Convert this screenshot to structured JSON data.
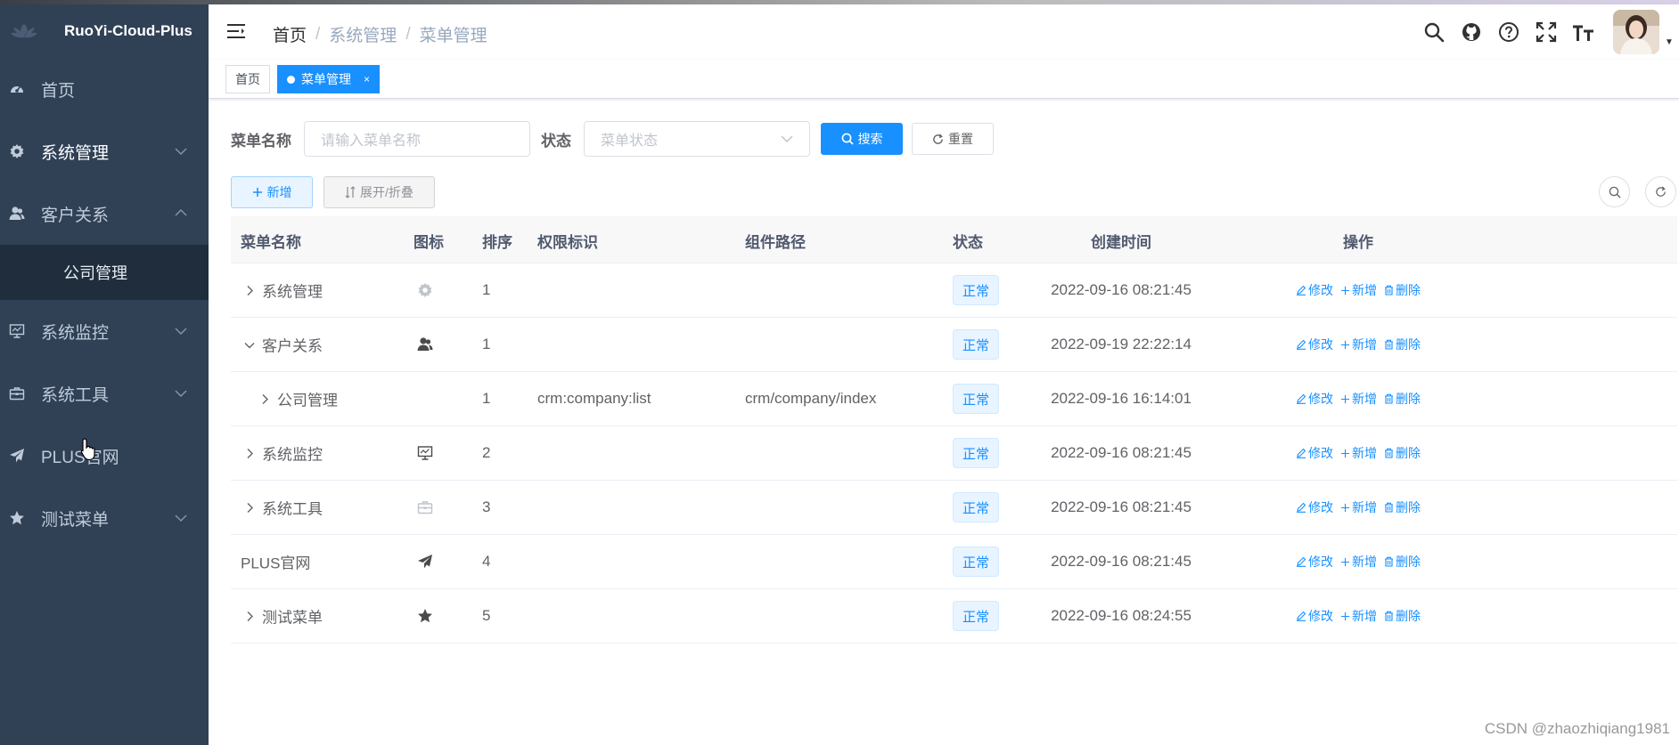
{
  "app": {
    "title": "RuoYi-Cloud-Plus"
  },
  "sidebar": {
    "items": [
      {
        "label": "首页",
        "icon": "dashboard-icon",
        "has_arrow": false
      },
      {
        "label": "系统管理",
        "icon": "gear-icon",
        "has_arrow": true,
        "expanded": false
      },
      {
        "label": "客户关系",
        "icon": "peoples-icon",
        "has_arrow": true,
        "expanded": true
      },
      {
        "label": "系统监控",
        "icon": "monitor-icon",
        "has_arrow": true,
        "expanded": false
      },
      {
        "label": "系统工具",
        "icon": "toolbox-icon",
        "has_arrow": true,
        "expanded": false
      },
      {
        "label": "PLUS官网",
        "icon": "paper-plane-icon",
        "has_arrow": false
      },
      {
        "label": "测试菜单",
        "icon": "star-icon",
        "has_arrow": true,
        "expanded": false
      }
    ],
    "submenu": [
      {
        "label": "公司管理"
      }
    ]
  },
  "header": {
    "breadcrumb": [
      "首页",
      "系统管理",
      "菜单管理"
    ],
    "icons": [
      "search-icon",
      "github-icon",
      "question-icon",
      "fullscreen-icon",
      "font-size-icon"
    ]
  },
  "tags": [
    {
      "label": "首页",
      "active": false
    },
    {
      "label": "菜单管理",
      "active": true,
      "close": "×"
    }
  ],
  "search": {
    "name_label": "菜单名称",
    "name_placeholder": "请输入菜单名称",
    "status_label": "状态",
    "status_placeholder": "菜单状态",
    "search_btn": "搜索",
    "reset_btn": "重置"
  },
  "toolbar": {
    "add_btn": "新增",
    "expand_btn": "展开/折叠"
  },
  "table": {
    "columns": [
      "菜单名称",
      "图标",
      "排序",
      "权限标识",
      "组件路径",
      "状态",
      "创建时间",
      "操作"
    ],
    "ops": {
      "edit": "修改",
      "add": "新增",
      "delete": "删除"
    },
    "rows": [
      {
        "name": "系统管理",
        "level": 0,
        "expander": "collapsed",
        "icon": "gear-icon",
        "sort": "1",
        "perm": "",
        "component": "",
        "status": "正常",
        "time": "2022-09-16 08:21:45"
      },
      {
        "name": "客户关系",
        "level": 0,
        "expander": "expanded",
        "icon": "peoples-icon",
        "sort": "1",
        "perm": "",
        "component": "",
        "status": "正常",
        "time": "2022-09-19 22:22:14"
      },
      {
        "name": "公司管理",
        "level": 1,
        "expander": "collapsed",
        "icon": "",
        "sort": "1",
        "perm": "crm:company:list",
        "component": "crm/company/index",
        "status": "正常",
        "time": "2022-09-16 16:14:01"
      },
      {
        "name": "系统监控",
        "level": 0,
        "expander": "collapsed",
        "icon": "monitor-icon",
        "sort": "2",
        "perm": "",
        "component": "",
        "status": "正常",
        "time": "2022-09-16 08:21:45"
      },
      {
        "name": "系统工具",
        "level": 0,
        "expander": "collapsed",
        "icon": "toolbox-icon",
        "sort": "3",
        "perm": "",
        "component": "",
        "status": "正常",
        "time": "2022-09-16 08:21:45"
      },
      {
        "name": "PLUS官网",
        "level": 0,
        "expander": "none",
        "icon": "paper-plane-icon",
        "sort": "4",
        "perm": "",
        "component": "",
        "status": "正常",
        "time": "2022-09-16 08:21:45"
      },
      {
        "name": "测试菜单",
        "level": 0,
        "expander": "collapsed",
        "icon": "star-icon",
        "sort": "5",
        "perm": "",
        "component": "",
        "status": "正常",
        "time": "2022-09-16 08:24:55"
      }
    ]
  },
  "watermark": "CSDN @zhaozhiqiang1981",
  "colors": {
    "sidebar_bg": "#304156",
    "primary": "#1890ff",
    "submenu_bg": "#1f2d3d"
  }
}
